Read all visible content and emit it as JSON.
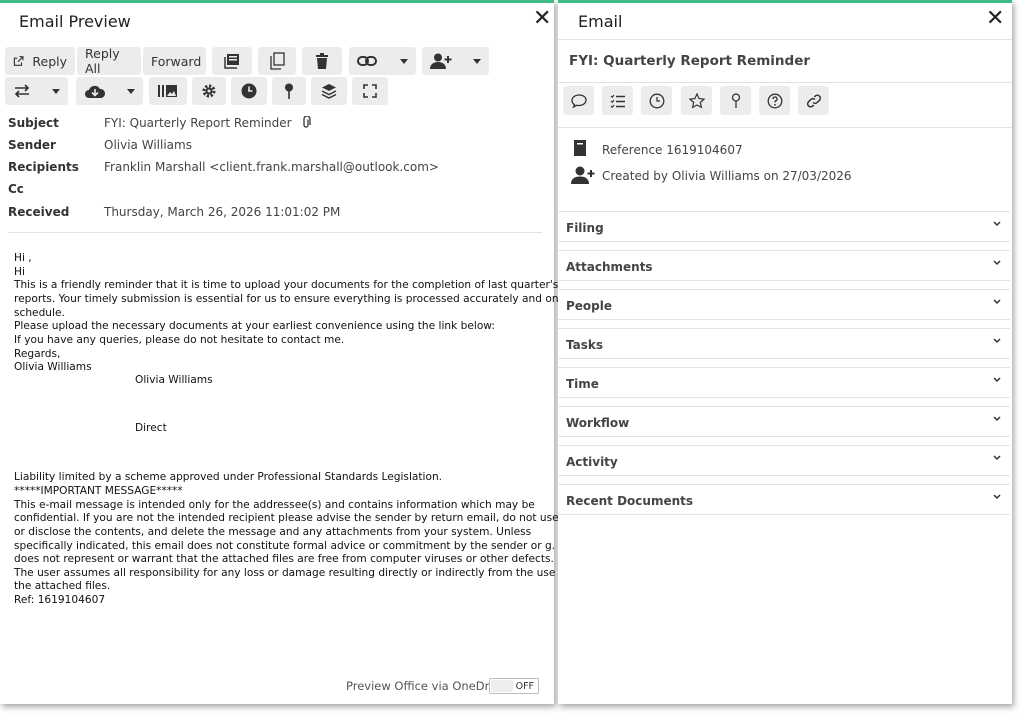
{
  "preview": {
    "title": "Email Preview",
    "toolbar": {
      "reply": "Reply",
      "reply_all": "Reply All",
      "forward": "Forward"
    },
    "meta": {
      "subject_label": "Subject",
      "subject": "FYI: Quarterly Report Reminder",
      "sender_label": "Sender",
      "sender": "Olivia Williams",
      "recipients_label": "Recipients",
      "recipients": "Franklin Marshall <client.frank.marshall@outlook.com>",
      "cc_label": "Cc",
      "cc": "",
      "received_label": "Received",
      "received": "Thursday, March 26, 2026 11:01:02 PM"
    },
    "body": {
      "l1": "Hi ,",
      "l2": "Hi",
      "l3": "This is a friendly reminder that it is time to upload your documents for the completion of last quarter's",
      "l4": "reports. Your timely submission is essential for us to ensure everything is processed accurately and on",
      "l5": "schedule.",
      "l6": "Please upload the necessary documents at your earliest convenience using the link below:",
      "l7": "If you have any queries, please do not hesitate to contact me.",
      "l8": "Regards,",
      "l9": "Olivia Williams",
      "sig_name": "Olivia Williams",
      "sig_direct": "Direct",
      "d1": "Liability limited by a scheme approved under Professional Standards Legislation.",
      "d2": "*****IMPORTANT MESSAGE*****",
      "d3": "This e-mail message is intended only for the addressee(s) and contains information which may be",
      "d4": "confidential.  If you are not the intended recipient please advise the sender by return email, do not use",
      "d5": "or disclose the contents, and delete the message and any attachments from your system.  Unless",
      "d6": "specifically indicated, this email does not constitute formal advice or commitment by the sender or g.",
      "d7": "does not represent or warrant that the attached files are free from computer viruses or other defects.",
      "d8": "The user assumes all responsibility for any loss or damage resulting directly or indirectly from the use of",
      "d9": "the attached files.",
      "d10": "Ref: 1619104607"
    },
    "onedrive_label": "Preview Office via OneDrive",
    "onedrive_toggle": "OFF"
  },
  "email": {
    "title": "Email",
    "subject": "FYI: Quarterly Report Reminder",
    "reference": "Reference 1619104607",
    "created": "Created by Olivia Williams on 27/03/2026",
    "sections": [
      "Filing",
      "Attachments",
      "People",
      "Tasks",
      "Time",
      "Workflow",
      "Activity",
      "Recent Documents"
    ]
  },
  "icons": {
    "reply": "reply-icon",
    "attachment": "paperclip-icon",
    "accent_color": "#3dbb87"
  }
}
